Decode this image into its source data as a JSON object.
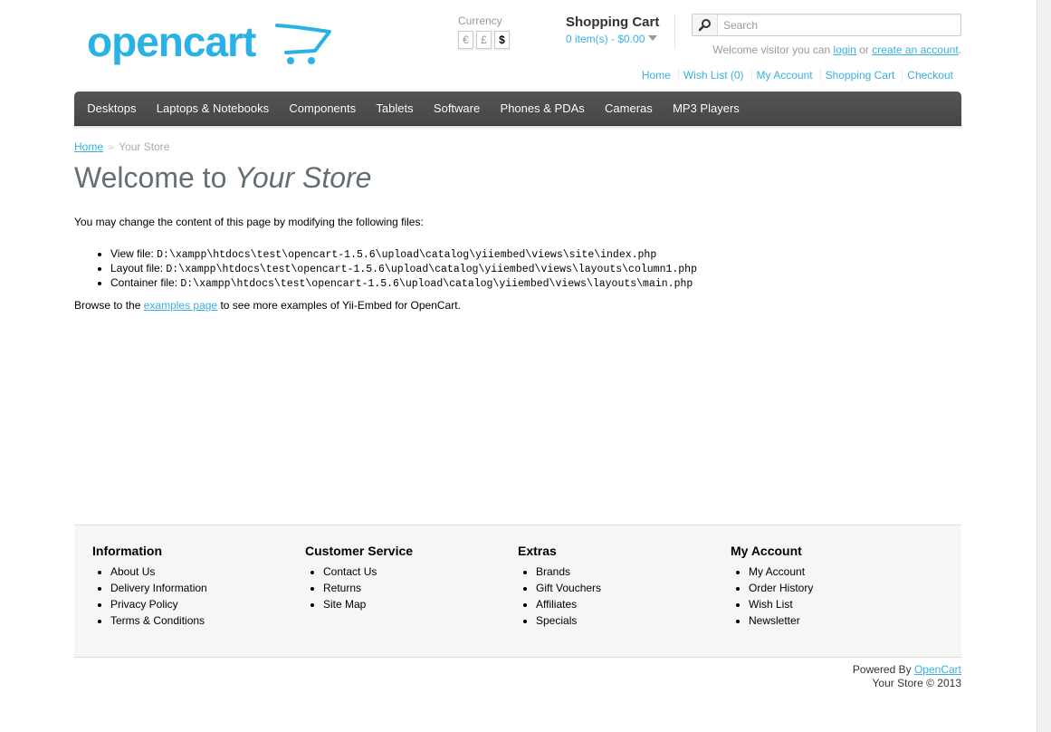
{
  "header": {
    "logo_text": "opencart",
    "currency": {
      "label": "Currency",
      "options": [
        "€",
        "£",
        "$"
      ],
      "selected": "$"
    },
    "cart": {
      "title": "Shopping Cart",
      "total": "0 item(s) - $0.00"
    },
    "search": {
      "placeholder": "Search",
      "value": ""
    },
    "welcome": {
      "prefix": "Welcome visitor you can ",
      "login": "login",
      "middle": " or ",
      "create": "create an account",
      "suffix": "."
    },
    "links": [
      "Home",
      "Wish List (0)",
      "My Account",
      "Shopping Cart",
      "Checkout"
    ]
  },
  "menu": [
    "Desktops",
    "Laptops & Notebooks",
    "Components",
    "Tablets",
    "Software",
    "Phones & PDAs",
    "Cameras",
    "MP3 Players"
  ],
  "breadcrumb": {
    "home": "Home",
    "separator": "»",
    "current": "Your Store"
  },
  "content": {
    "heading_prefix": "Welcome to ",
    "heading_store": "Your Store",
    "intro": "You may change the content of this page by modifying the following files:",
    "files": [
      {
        "label": "View file: ",
        "path": "D:\\xampp\\htdocs\\test\\opencart-1.5.6\\upload\\catalog\\yiiembed\\views\\site\\index.php"
      },
      {
        "label": "Layout file: ",
        "path": "D:\\xampp\\htdocs\\test\\opencart-1.5.6\\upload\\catalog\\yiiembed\\views\\layouts\\column1.php"
      },
      {
        "label": "Container file: ",
        "path": "D:\\xampp\\htdocs\\test\\opencart-1.5.6\\upload\\catalog\\yiiembed\\views\\layouts\\main.php"
      }
    ],
    "browse_prefix": "Browse to the ",
    "browse_link": "examples page",
    "browse_suffix": " to see more examples of Yii-Embed for OpenCart."
  },
  "footer": {
    "columns": [
      {
        "title": "Information",
        "items": [
          "About Us",
          "Delivery Information",
          "Privacy Policy",
          "Terms & Conditions"
        ]
      },
      {
        "title": "Customer Service",
        "items": [
          "Contact Us",
          "Returns",
          "Site Map"
        ]
      },
      {
        "title": "Extras",
        "items": [
          "Brands",
          "Gift Vouchers",
          "Affiliates",
          "Specials"
        ]
      },
      {
        "title": "My Account",
        "items": [
          "My Account",
          "Order History",
          "Wish List",
          "Newsletter"
        ]
      }
    ],
    "powered_prefix": "Powered By ",
    "powered_link": "OpenCart",
    "copyright": "Your Store © 2013"
  },
  "colors": {
    "accent": "#38b0e3",
    "menu_bg": "#4f4f4f",
    "footer_bg": "#f6f6f6",
    "heading": "#636e75"
  }
}
